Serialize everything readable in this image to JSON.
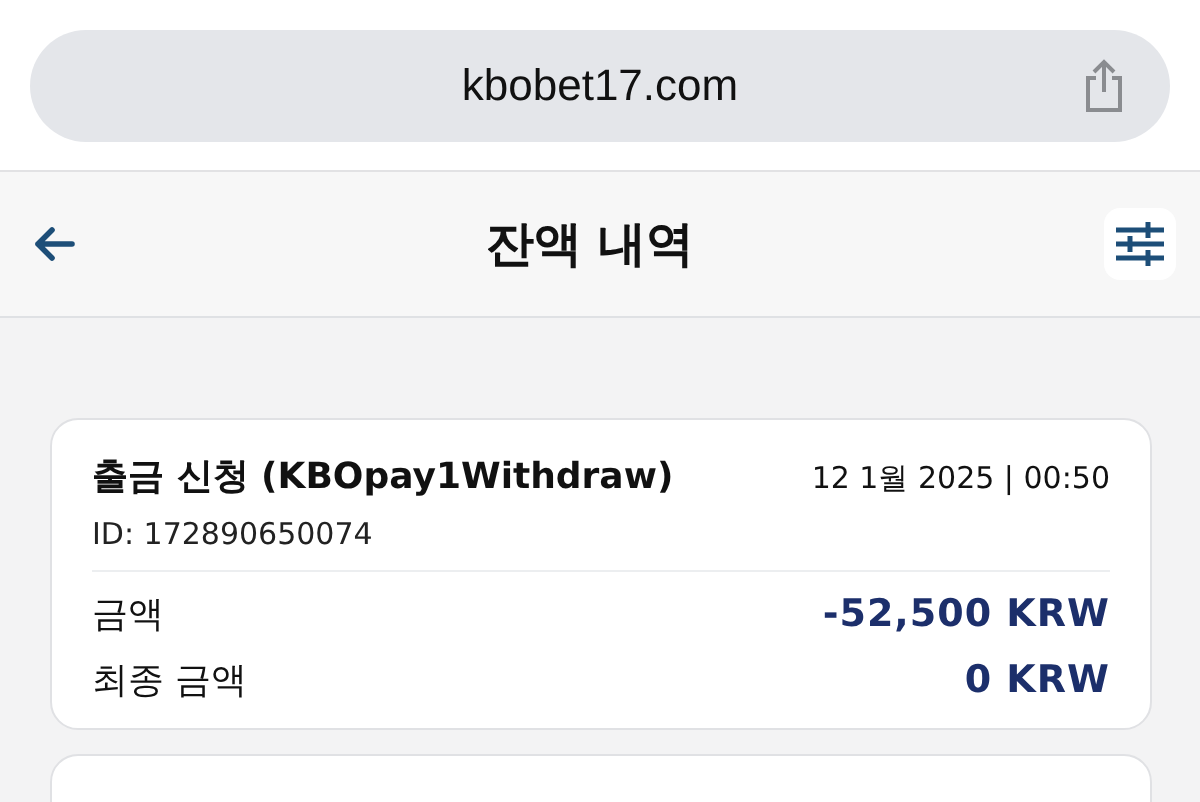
{
  "browser": {
    "url": "kbobet17.com"
  },
  "header": {
    "title": "잔액 내역"
  },
  "transactions": [
    {
      "title": "출금 신청 (KBOpay1Withdraw)",
      "date": "12 1월 2025 | 00:50",
      "id": "ID: 172890650074",
      "rows": [
        {
          "label": "금액",
          "value": "-52,500 KRW"
        },
        {
          "label": "최종 금액",
          "value": "0 KRW"
        }
      ]
    }
  ]
}
